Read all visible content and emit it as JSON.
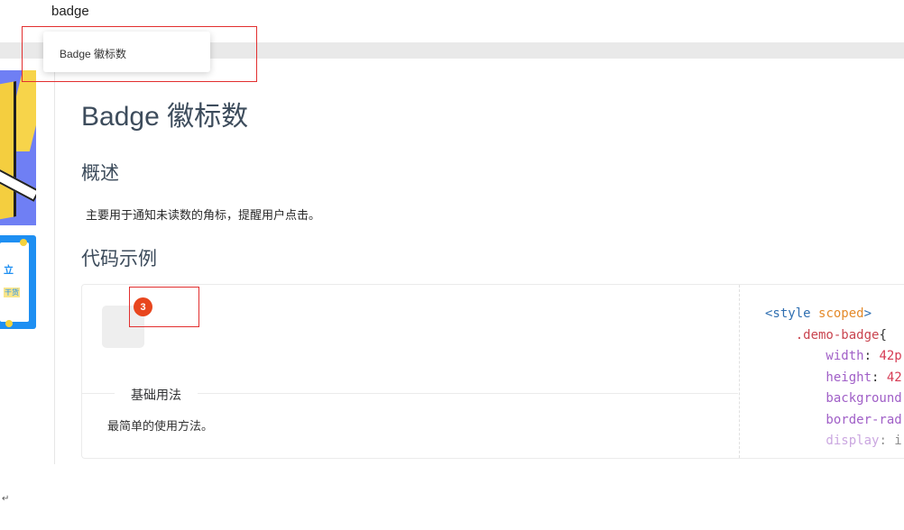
{
  "search": {
    "query": "badge"
  },
  "dropdown": {
    "items": [
      {
        "label": "Badge 徽标数"
      }
    ]
  },
  "banners": {
    "second": {
      "line1": "立",
      "line2": "干货"
    }
  },
  "page": {
    "title": "Badge 徽标数",
    "overview_heading": "概述",
    "overview_text": "主要用于通知未读数的角标，提醒用户点击。",
    "examples_heading": "代码示例"
  },
  "demo": {
    "badge_count": "3",
    "meta_title": "基础用法",
    "meta_description": "最简单的使用方法。",
    "code_lines": [
      [
        {
          "t": "<style ",
          "c": "tag"
        },
        {
          "t": "scoped",
          "c": "attr"
        },
        {
          "t": ">",
          "c": "tag"
        }
      ],
      [
        {
          "t": "    .demo-badge",
          "c": "sel"
        },
        {
          "t": "{",
          "c": "punc"
        }
      ],
      [
        {
          "t": "        width",
          "c": "prop"
        },
        {
          "t": ": ",
          "c": "punc"
        },
        {
          "t": "42p",
          "c": "val"
        }
      ],
      [
        {
          "t": "        height",
          "c": "prop"
        },
        {
          "t": ": ",
          "c": "punc"
        },
        {
          "t": "42",
          "c": "val"
        }
      ],
      [
        {
          "t": "        background",
          "c": "prop"
        }
      ],
      [
        {
          "t": "        border-rad",
          "c": "prop"
        }
      ],
      [
        {
          "t": "        display",
          "c": "prop",
          "faded": true
        },
        {
          "t": ": ",
          "c": "punc",
          "faded": true
        },
        {
          "t": "i",
          "c": "punc",
          "faded": true
        }
      ]
    ]
  },
  "footer": {
    "return_mark": "↵"
  },
  "colors": {
    "badge": "#e8461e",
    "title": "#3d4c5c",
    "annotation_box": "#e22f2f"
  }
}
